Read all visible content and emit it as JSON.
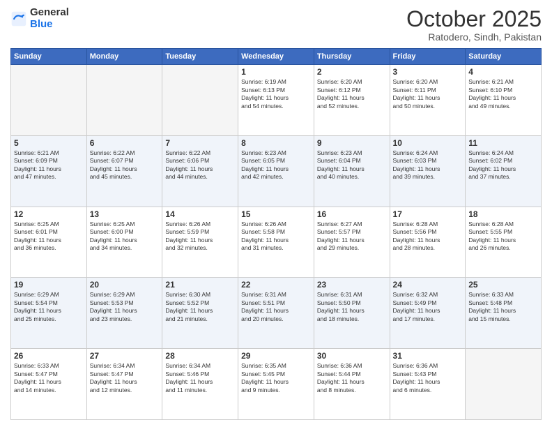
{
  "logo": {
    "general": "General",
    "blue": "Blue"
  },
  "title": "October 2025",
  "subtitle": "Ratodero, Sindh, Pakistan",
  "days": [
    "Sunday",
    "Monday",
    "Tuesday",
    "Wednesday",
    "Thursday",
    "Friday",
    "Saturday"
  ],
  "weeks": [
    [
      {
        "day": "",
        "info": ""
      },
      {
        "day": "",
        "info": ""
      },
      {
        "day": "",
        "info": ""
      },
      {
        "day": "1",
        "info": "Sunrise: 6:19 AM\nSunset: 6:13 PM\nDaylight: 11 hours\nand 54 minutes."
      },
      {
        "day": "2",
        "info": "Sunrise: 6:20 AM\nSunset: 6:12 PM\nDaylight: 11 hours\nand 52 minutes."
      },
      {
        "day": "3",
        "info": "Sunrise: 6:20 AM\nSunset: 6:11 PM\nDaylight: 11 hours\nand 50 minutes."
      },
      {
        "day": "4",
        "info": "Sunrise: 6:21 AM\nSunset: 6:10 PM\nDaylight: 11 hours\nand 49 minutes."
      }
    ],
    [
      {
        "day": "5",
        "info": "Sunrise: 6:21 AM\nSunset: 6:09 PM\nDaylight: 11 hours\nand 47 minutes."
      },
      {
        "day": "6",
        "info": "Sunrise: 6:22 AM\nSunset: 6:07 PM\nDaylight: 11 hours\nand 45 minutes."
      },
      {
        "day": "7",
        "info": "Sunrise: 6:22 AM\nSunset: 6:06 PM\nDaylight: 11 hours\nand 44 minutes."
      },
      {
        "day": "8",
        "info": "Sunrise: 6:23 AM\nSunset: 6:05 PM\nDaylight: 11 hours\nand 42 minutes."
      },
      {
        "day": "9",
        "info": "Sunrise: 6:23 AM\nSunset: 6:04 PM\nDaylight: 11 hours\nand 40 minutes."
      },
      {
        "day": "10",
        "info": "Sunrise: 6:24 AM\nSunset: 6:03 PM\nDaylight: 11 hours\nand 39 minutes."
      },
      {
        "day": "11",
        "info": "Sunrise: 6:24 AM\nSunset: 6:02 PM\nDaylight: 11 hours\nand 37 minutes."
      }
    ],
    [
      {
        "day": "12",
        "info": "Sunrise: 6:25 AM\nSunset: 6:01 PM\nDaylight: 11 hours\nand 36 minutes."
      },
      {
        "day": "13",
        "info": "Sunrise: 6:25 AM\nSunset: 6:00 PM\nDaylight: 11 hours\nand 34 minutes."
      },
      {
        "day": "14",
        "info": "Sunrise: 6:26 AM\nSunset: 5:59 PM\nDaylight: 11 hours\nand 32 minutes."
      },
      {
        "day": "15",
        "info": "Sunrise: 6:26 AM\nSunset: 5:58 PM\nDaylight: 11 hours\nand 31 minutes."
      },
      {
        "day": "16",
        "info": "Sunrise: 6:27 AM\nSunset: 5:57 PM\nDaylight: 11 hours\nand 29 minutes."
      },
      {
        "day": "17",
        "info": "Sunrise: 6:28 AM\nSunset: 5:56 PM\nDaylight: 11 hours\nand 28 minutes."
      },
      {
        "day": "18",
        "info": "Sunrise: 6:28 AM\nSunset: 5:55 PM\nDaylight: 11 hours\nand 26 minutes."
      }
    ],
    [
      {
        "day": "19",
        "info": "Sunrise: 6:29 AM\nSunset: 5:54 PM\nDaylight: 11 hours\nand 25 minutes."
      },
      {
        "day": "20",
        "info": "Sunrise: 6:29 AM\nSunset: 5:53 PM\nDaylight: 11 hours\nand 23 minutes."
      },
      {
        "day": "21",
        "info": "Sunrise: 6:30 AM\nSunset: 5:52 PM\nDaylight: 11 hours\nand 21 minutes."
      },
      {
        "day": "22",
        "info": "Sunrise: 6:31 AM\nSunset: 5:51 PM\nDaylight: 11 hours\nand 20 minutes."
      },
      {
        "day": "23",
        "info": "Sunrise: 6:31 AM\nSunset: 5:50 PM\nDaylight: 11 hours\nand 18 minutes."
      },
      {
        "day": "24",
        "info": "Sunrise: 6:32 AM\nSunset: 5:49 PM\nDaylight: 11 hours\nand 17 minutes."
      },
      {
        "day": "25",
        "info": "Sunrise: 6:33 AM\nSunset: 5:48 PM\nDaylight: 11 hours\nand 15 minutes."
      }
    ],
    [
      {
        "day": "26",
        "info": "Sunrise: 6:33 AM\nSunset: 5:47 PM\nDaylight: 11 hours\nand 14 minutes."
      },
      {
        "day": "27",
        "info": "Sunrise: 6:34 AM\nSunset: 5:47 PM\nDaylight: 11 hours\nand 12 minutes."
      },
      {
        "day": "28",
        "info": "Sunrise: 6:34 AM\nSunset: 5:46 PM\nDaylight: 11 hours\nand 11 minutes."
      },
      {
        "day": "29",
        "info": "Sunrise: 6:35 AM\nSunset: 5:45 PM\nDaylight: 11 hours\nand 9 minutes."
      },
      {
        "day": "30",
        "info": "Sunrise: 6:36 AM\nSunset: 5:44 PM\nDaylight: 11 hours\nand 8 minutes."
      },
      {
        "day": "31",
        "info": "Sunrise: 6:36 AM\nSunset: 5:43 PM\nDaylight: 11 hours\nand 6 minutes."
      },
      {
        "day": "",
        "info": ""
      }
    ]
  ]
}
